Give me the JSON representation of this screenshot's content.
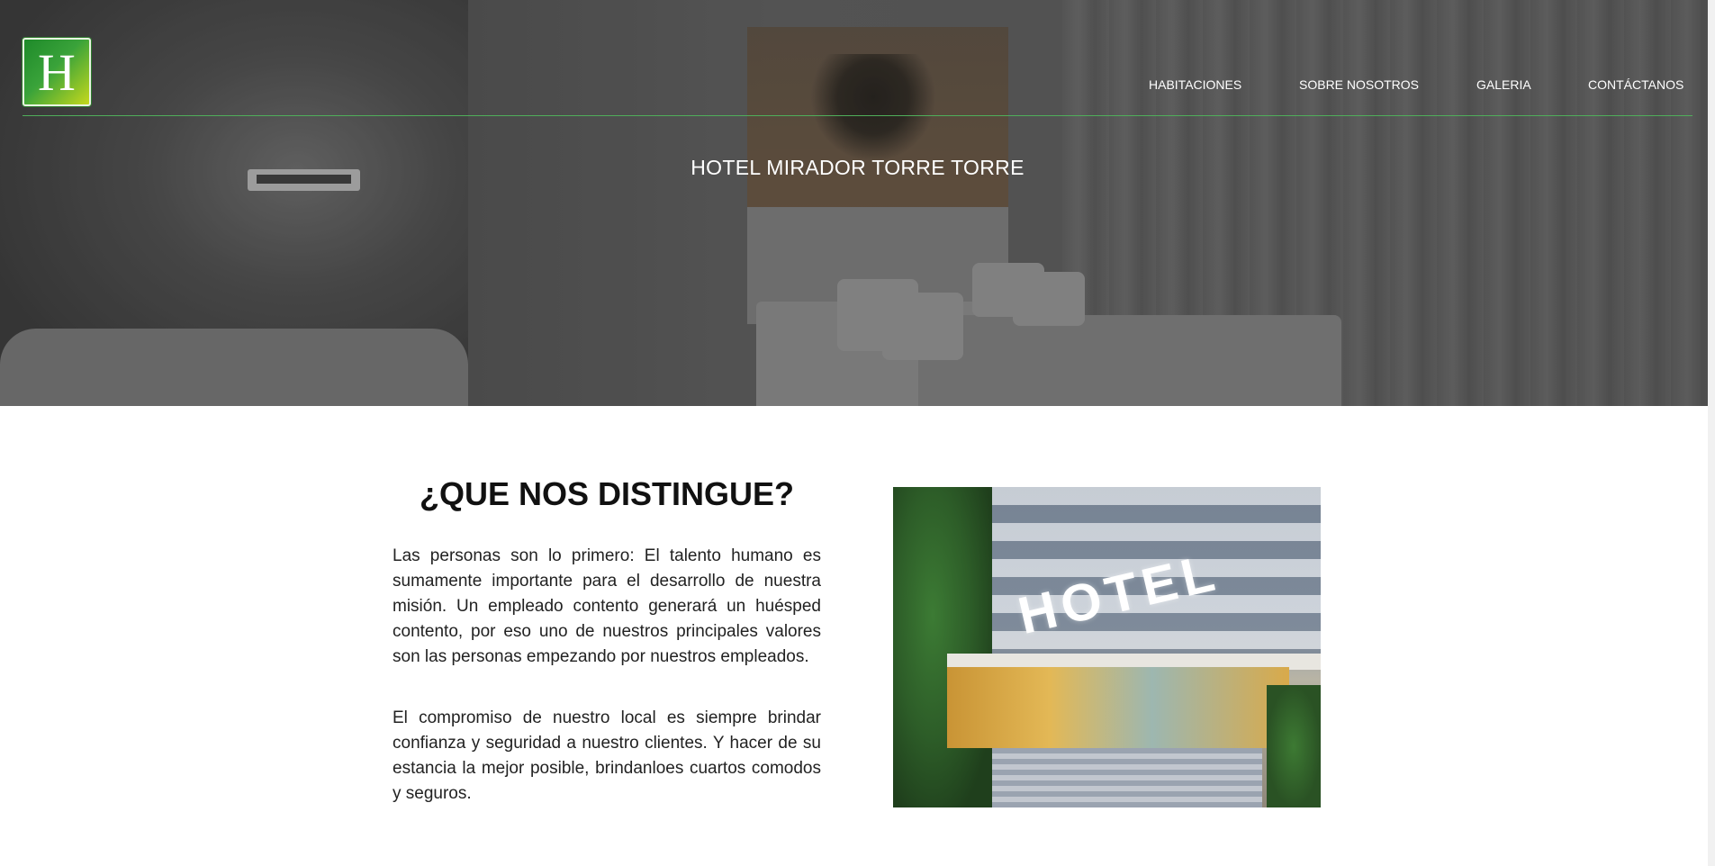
{
  "header": {
    "logo_letter": "H",
    "nav": [
      "HABITACIONES",
      "SOBRE NOSOTROS",
      "GALERIA",
      "CONTÁCTANOS"
    ],
    "title": "HOTEL MIRADOR TORRE TORRE"
  },
  "main": {
    "section_title": "¿QUE NOS DISTINGUE?",
    "paragraphs": [
      "Las personas son lo primero: El talento humano es sumamente importante para el desarrollo de nuestra misión. Un empleado contento generará un huésped contento, por eso uno de nuestros principales valores son las personas empezando por nuestros empleados.",
      "El compromiso de nuestro local es siempre brindar confianza y seguridad a nuestro clientes. Y hacer de su estancia la mejor posible, brindanloes cuartos comodos y seguros."
    ],
    "photo_sign": "HOTEL"
  },
  "colors": {
    "accent_green": "#3aa33a",
    "nav_line": "#4fae5a"
  }
}
